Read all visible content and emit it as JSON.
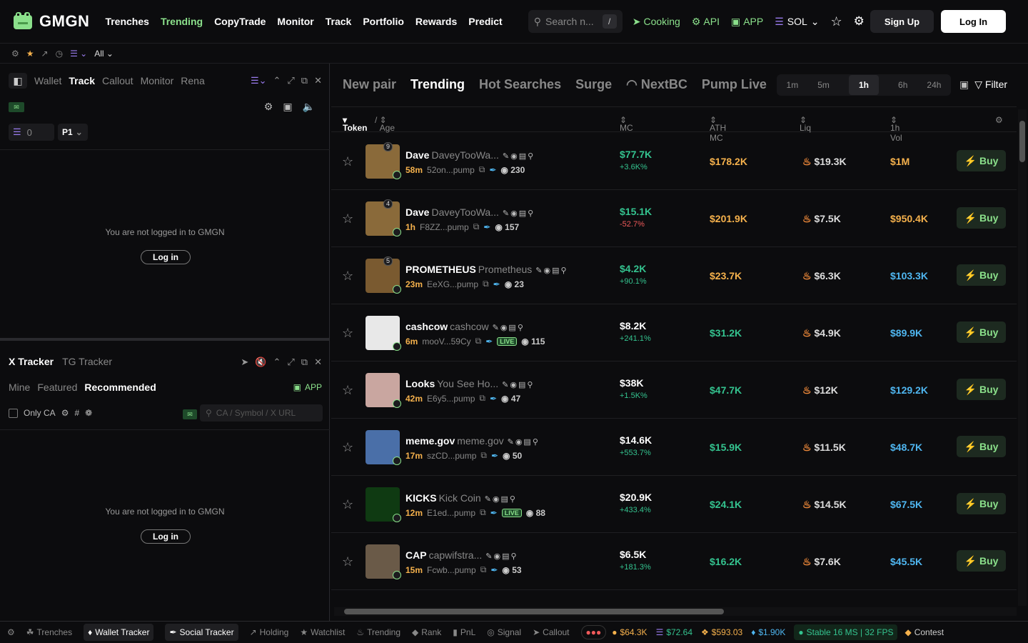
{
  "logo": "GMGN",
  "nav": [
    "Trenches",
    "Trending",
    "CopyTrade",
    "Monitor",
    "Track",
    "Portfolio",
    "Rewards",
    "Predict"
  ],
  "nav_active": "Trending",
  "search": {
    "placeholder": "Search n...",
    "kbd": "/"
  },
  "top": {
    "cooking": "Cooking",
    "api": "API",
    "app": "APP",
    "chain": "SOL",
    "signup": "Sign Up",
    "login": "Log In"
  },
  "subbar": {
    "all": "All"
  },
  "left_top": {
    "tabs": [
      "Wallet",
      "Track",
      "Callout",
      "Monitor",
      "Rena"
    ],
    "active": "Track",
    "count": "0",
    "preset": "P1",
    "not_logged": "You are not logged in to GMGN",
    "login": "Log in"
  },
  "left_bottom": {
    "tabs": [
      "X Tracker",
      "TG Tracker"
    ],
    "subtabs": [
      "Mine",
      "Featured",
      "Recommended"
    ],
    "app": "APP",
    "only_ca": "Only CA",
    "search_placeholder": "CA / Symbol / X URL",
    "not_logged": "You are not logged in to GMGN",
    "login": "Log in"
  },
  "main_tabs": [
    "New pair",
    "Trending",
    "Hot Searches",
    "Surge",
    "NextBC",
    "Pump Live"
  ],
  "main_active": "Trending",
  "timeframes": [
    "1m",
    "5m",
    "1h",
    "6h",
    "24h"
  ],
  "timeframe_active": "1h",
  "filter": "Filter",
  "columns": {
    "token": "Token",
    "age": "Age",
    "mc": "MC",
    "ath": "ATH MC",
    "liq": "Liq",
    "vol": "1h Vol"
  },
  "rows": [
    {
      "symbol": "Dave",
      "name": "DaveyTooWa...",
      "rank": "9",
      "age": "58m",
      "addr": "52on...pump",
      "holders": "230",
      "mc": "$77.7K",
      "change": "+3.6K%",
      "ath": "$178.2K",
      "liq": "$19.3K",
      "vol": "$1M",
      "avatar_color": "#8a6a3a",
      "live": "",
      "buy": "Buy"
    },
    {
      "symbol": "Dave",
      "name": "DaveyTooWa...",
      "rank": "4",
      "age": "1h",
      "addr": "F8ZZ...pump",
      "holders": "157",
      "mc": "$15.1K",
      "change": "-52.7%",
      "ath": "$201.9K",
      "liq": "$7.5K",
      "vol": "$950.4K",
      "avatar_color": "#8a6a3a",
      "live": "",
      "buy": "Buy"
    },
    {
      "symbol": "PROMETHEUS",
      "name": "Prometheus",
      "rank": "5",
      "age": "23m",
      "addr": "EeXG...pump",
      "holders": "23",
      "mc": "$4.2K",
      "change": "+90.1%",
      "ath": "$23.7K",
      "liq": "$6.3K",
      "vol": "$103.3K",
      "avatar_color": "#7a5a30",
      "live": "",
      "buy": "Buy"
    },
    {
      "symbol": "cashcow",
      "name": "cashcow",
      "rank": "",
      "age": "6m",
      "addr": "mooV...59Cy",
      "holders": "115",
      "mc": "$8.2K",
      "change": "+241.1%",
      "ath": "$31.2K",
      "liq": "$4.9K",
      "vol": "$89.9K",
      "avatar_color": "#e8e8e8",
      "live": "LIVE",
      "buy": "Buy"
    },
    {
      "symbol": "Looks",
      "name": "You See Ho...",
      "rank": "",
      "age": "42m",
      "addr": "E6y5...pump",
      "holders": "47",
      "mc": "$38K",
      "change": "+1.5K%",
      "ath": "$47.7K",
      "liq": "$12K",
      "vol": "$129.2K",
      "avatar_color": "#c9a6a0",
      "live": "",
      "buy": "Buy"
    },
    {
      "symbol": "meme.gov",
      "name": "meme.gov",
      "rank": "",
      "age": "17m",
      "addr": "szCD...pump",
      "holders": "50",
      "mc": "$14.6K",
      "change": "+553.7%",
      "ath": "$15.9K",
      "liq": "$11.5K",
      "vol": "$48.7K",
      "avatar_color": "#4a6fa8",
      "live": "",
      "buy": "Buy"
    },
    {
      "symbol": "KICKS",
      "name": "Kick Coin",
      "rank": "",
      "age": "12m",
      "addr": "E1ed...pump",
      "holders": "88",
      "mc": "$20.9K",
      "change": "+433.4%",
      "ath": "$24.1K",
      "liq": "$14.5K",
      "vol": "$67.5K",
      "avatar_color": "#0f3a12",
      "live": "LIVE",
      "buy": "Buy"
    },
    {
      "symbol": "CAP",
      "name": "capwifstra...",
      "rank": "",
      "age": "15m",
      "addr": "Fcwb...pump",
      "holders": "53",
      "mc": "$6.5K",
      "change": "+181.3%",
      "ath": "$16.2K",
      "liq": "$7.6K",
      "vol": "$45.5K",
      "avatar_color": "#6a5a48",
      "live": "",
      "buy": "Buy"
    }
  ],
  "bottom": {
    "items": [
      "Trenches",
      "Wallet Tracker",
      "Social Tracker",
      "Holding",
      "Watchlist",
      "Trending",
      "Rank",
      "PnL",
      "Signal",
      "Callout"
    ],
    "btc": "$64.3K",
    "sol": "$72.64",
    "bnb": "$593.03",
    "eth": "$1.90K",
    "status": "Stable 16 MS | 32 FPS",
    "contest": "Contest"
  },
  "colors": {
    "green": "#8be08b",
    "red": "#f05a5a",
    "yellow": "#f5b14c",
    "blue": "#4fb6f0",
    "teal": "#34c38f"
  }
}
